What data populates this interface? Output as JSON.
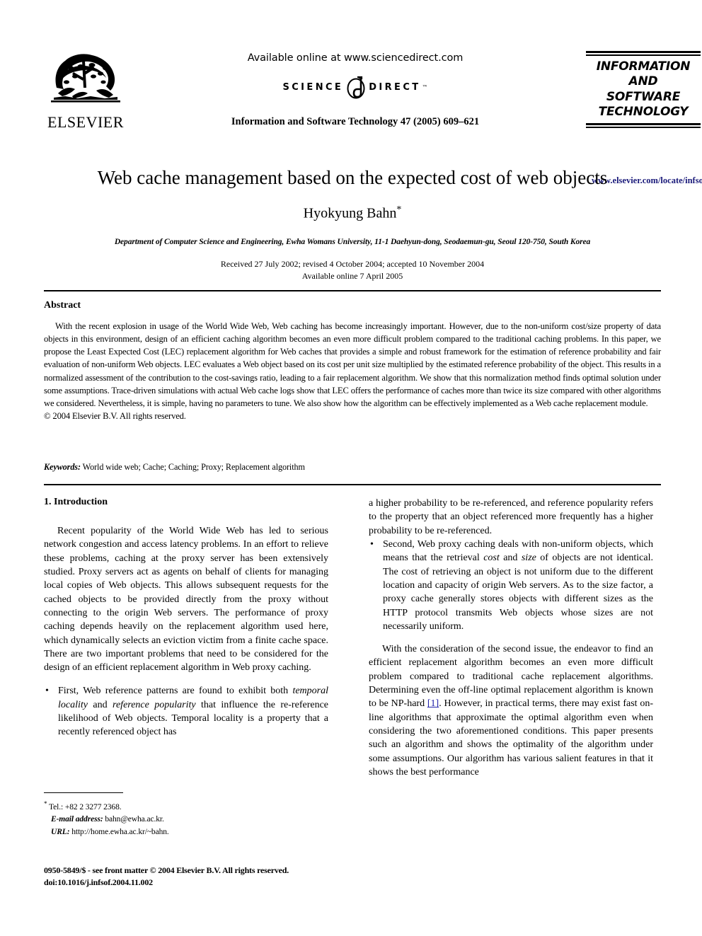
{
  "masthead": {
    "publisher_name": "ELSEVIER",
    "sciencedirect": {
      "available_line": "Available online at www.sciencedirect.com",
      "word_left": "SCIENCE",
      "word_right": "DIRECT",
      "trademark": "™"
    },
    "journal_reference": "Information and Software Technology 47 (2005) 609–621",
    "journal_box": {
      "line1": "INFORMATION",
      "line2": "AND",
      "line3": "SOFTWARE",
      "line4": "TECHNOLOGY"
    },
    "journal_url": "www.elsevier.com/locate/infsof",
    "journal_url_color": "#1a1a7a"
  },
  "title_block": {
    "title": "Web cache management based on the expected cost of web objects",
    "author": "Hyokyung Bahn",
    "author_footnote_marker": "*",
    "affiliation": "Department of Computer Science and Engineering, Ewha Womans University, 11-1 Daehyun-dong, Seodaemun-gu, Seoul 120-750, South Korea",
    "received_line": "Received 27 July 2002; revised 4 October 2004; accepted 10 November 2004",
    "available_line": "Available online 7 April 2005"
  },
  "abstract": {
    "heading": "Abstract",
    "body": "With the recent explosion in usage of the World Wide Web, Web caching has become increasingly important. However, due to the non-uniform cost/size property of data objects in this environment, design of an efficient caching algorithm becomes an even more difficult problem compared to the traditional caching problems. In this paper, we propose the Least Expected Cost (LEC) replacement algorithm for Web caches that provides a simple and robust framework for the estimation of reference probability and fair evaluation of non-uniform Web objects. LEC evaluates a Web object based on its cost per unit size multiplied by the estimated reference probability of the object. This results in a normalized assessment of the contribution to the cost-savings ratio, leading to a fair replacement algorithm. We show that this normalization method finds optimal solution under some assumptions. Trace-driven simulations with actual Web cache logs show that LEC offers the performance of caches more than twice its size compared with other algorithms we considered. Nevertheless, it is simple, having no parameters to tune. We also show how the algorithm can be effectively implemented as a Web cache replacement module.",
    "copyright": "© 2004 Elsevier B.V. All rights reserved."
  },
  "keywords": {
    "label": "Keywords:",
    "value": "World wide web; Cache; Caching; Proxy; Replacement algorithm"
  },
  "body": {
    "section_heading": "1. Introduction",
    "left_column": {
      "paragraph1": "Recent popularity of the World Wide Web has led to serious network congestion and access latency problems. In an effort to relieve these problems, caching at the proxy server has been extensively studied. Proxy servers act as agents on behalf of clients for managing local copies of Web objects. This allows subsequent requests for the cached objects to be provided directly from the proxy without connecting to the origin Web servers. The performance of proxy caching depends heavily on the replacement algorithm used here, which dynamically selects an eviction victim from a finite cache space. There are two important problems that need to be considered for the design of an efficient replacement algorithm in Web proxy caching.",
      "bullet1_part1": "First, Web reference patterns are found to exhibit both ",
      "bullet1_em1": "temporal locality",
      "bullet1_part2": " and ",
      "bullet1_em2": "reference popularity",
      "bullet1_part3": " that influence the re-reference likelihood of Web objects. Temporal locality is a property that a recently referenced object has"
    },
    "right_column": {
      "continuation": "a higher probability to be re-referenced, and reference popularity refers to the property that an object referenced more frequently has a higher probability to be re-referenced.",
      "bullet2_part1": "Second, Web proxy caching deals with non-uniform objects, which means that the retrieval ",
      "bullet2_em1": "cost",
      "bullet2_part2": " and ",
      "bullet2_em2": "size",
      "bullet2_part3": " of objects are not identical. The cost of retrieving an object is not uniform due to the different location and capacity of origin Web servers. As to the size factor, a proxy cache generally stores objects with different sizes as the HTTP protocol transmits Web objects whose sizes are not necessarily uniform.",
      "paragraph_part1": "With the consideration of the second issue, the endeavor to find an efficient replacement algorithm becomes an even more difficult problem compared to traditional cache replacement algorithms. Determining even the off-line optimal replacement algorithm is known to be NP-hard ",
      "citation": "[1]",
      "paragraph_part2": ". However, in practical terms, there may exist fast on-line algorithms that approximate the optimal algorithm even when considering the two aforementioned conditions. This paper presents such an algorithm and shows the optimality of the algorithm under some assumptions. Our algorithm has various salient features in that it shows the best performance"
    }
  },
  "footnote": {
    "marker": "*",
    "tel_label": "Tel.:",
    "tel_value": "+82 2 3277 2368.",
    "email_label": "E-mail address:",
    "email_value": "bahn@ewha.ac.kr.",
    "url_label": "URL:",
    "url_value": "http://home.ewha.ac.kr/~bahn."
  },
  "imprint": {
    "line1": "0950-5849/$ - see front matter © 2004 Elsevier B.V. All rights reserved.",
    "line2": "doi:10.1016/j.infsof.2004.11.002"
  },
  "colors": {
    "text": "#000000",
    "link": "#2222aa",
    "journal_url": "#1a1a7a"
  }
}
